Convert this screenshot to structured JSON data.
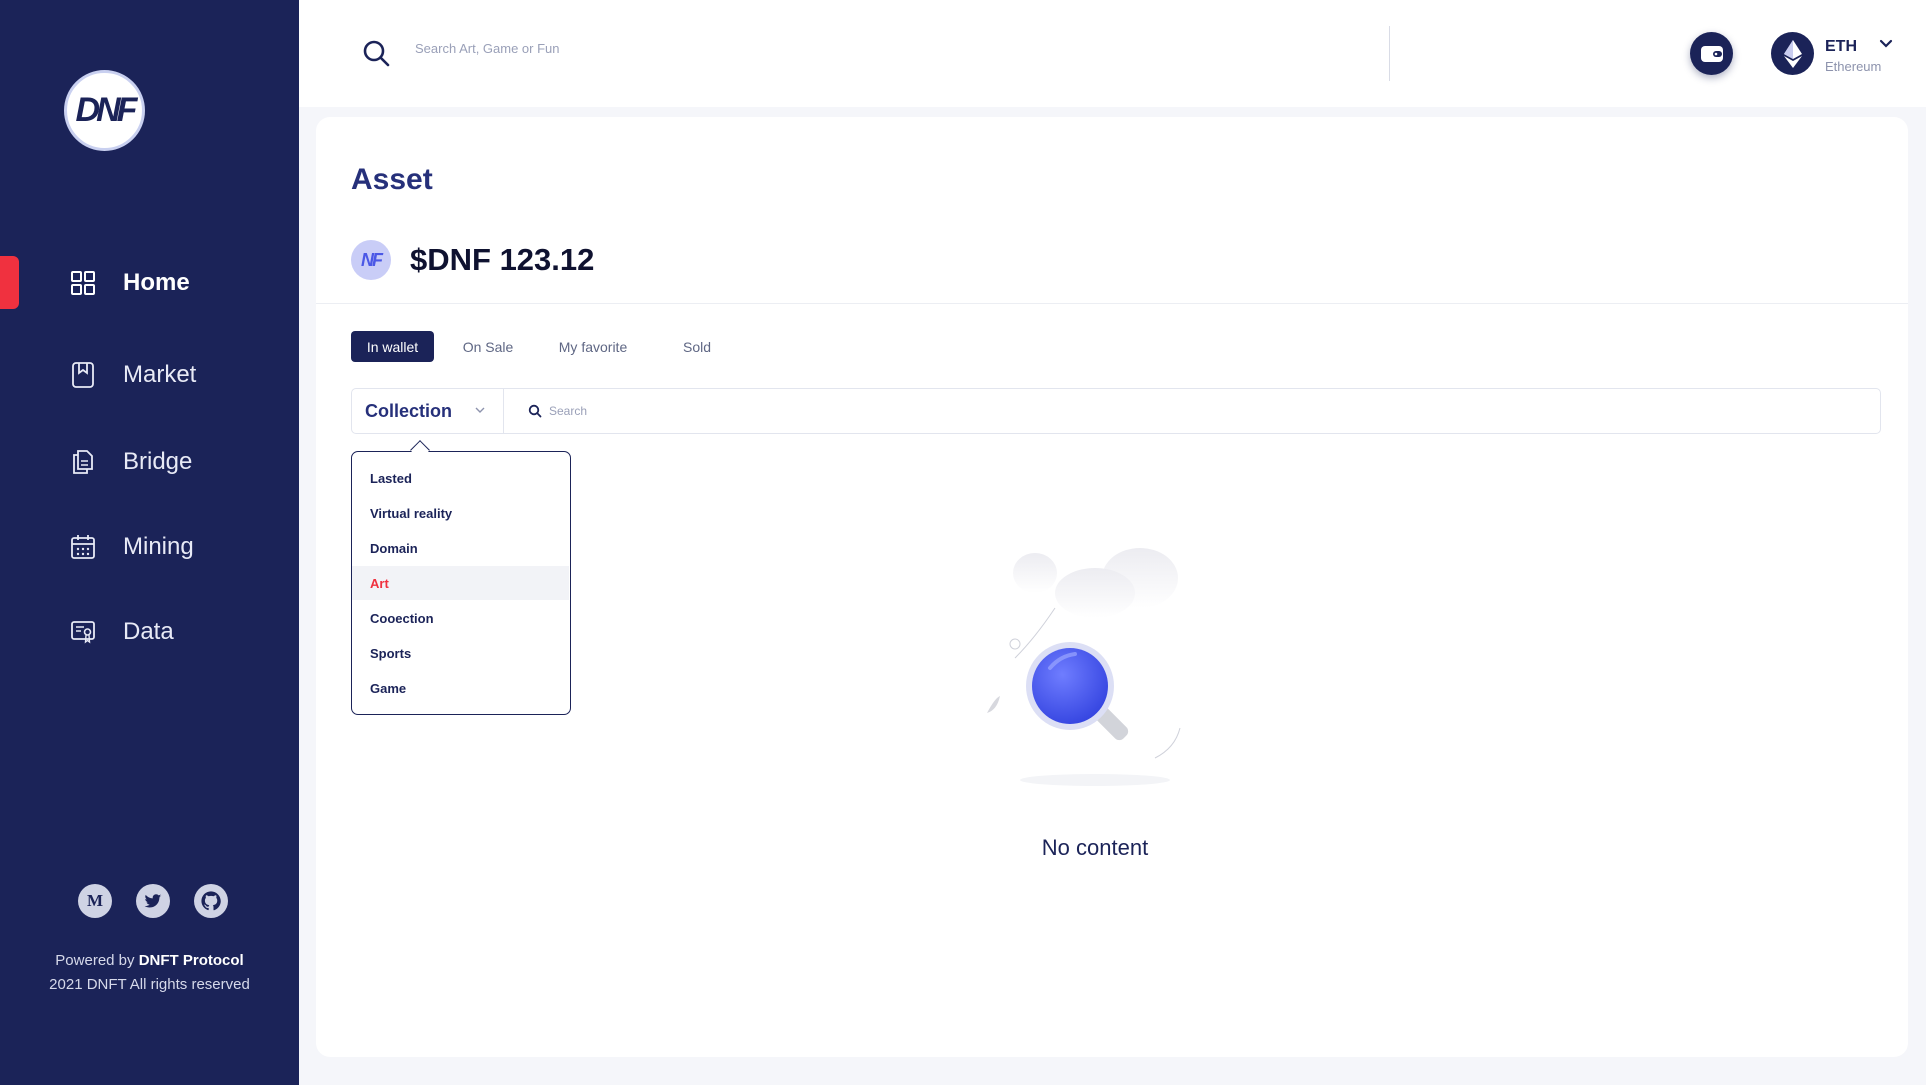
{
  "brand": {
    "logo_text": "DNF"
  },
  "sidebar": {
    "items": [
      {
        "label": "Home",
        "icon": "grid-icon"
      },
      {
        "label": "Market",
        "icon": "bookmark-icon"
      },
      {
        "label": "Bridge",
        "icon": "documents-icon"
      },
      {
        "label": "Mining",
        "icon": "calendar-icon"
      },
      {
        "label": "Data",
        "icon": "certificate-icon"
      }
    ],
    "socials": [
      {
        "name": "medium-icon",
        "glyph": "M"
      },
      {
        "name": "twitter-icon",
        "glyph": ""
      },
      {
        "name": "github-icon",
        "glyph": ""
      }
    ],
    "powered_prefix": "Powered by ",
    "powered_brand": "DNFT Protocol",
    "copyright": "2021 DNFT All rights reserved"
  },
  "header": {
    "search_placeholder": "Search Art, Game or Fun",
    "network_symbol": "ETH",
    "network_name": "Ethereum"
  },
  "main": {
    "title": "Asset",
    "token_icon_text": "NF",
    "balance": "$DNF 123.12",
    "tabs": [
      "In wallet",
      "On Sale",
      "My favorite",
      "Sold"
    ],
    "filter": {
      "collection_label": "Collection",
      "search_placeholder": "Search"
    },
    "dropdown_items": [
      "Lasted",
      "Virtual reality",
      "Domain",
      "Art",
      "Cooection",
      "Sports",
      "Game"
    ],
    "empty_text": "No content"
  },
  "colors": {
    "sidebar_bg": "#1b2358",
    "accent_red": "#f0313f",
    "primary_text": "#26307a"
  }
}
